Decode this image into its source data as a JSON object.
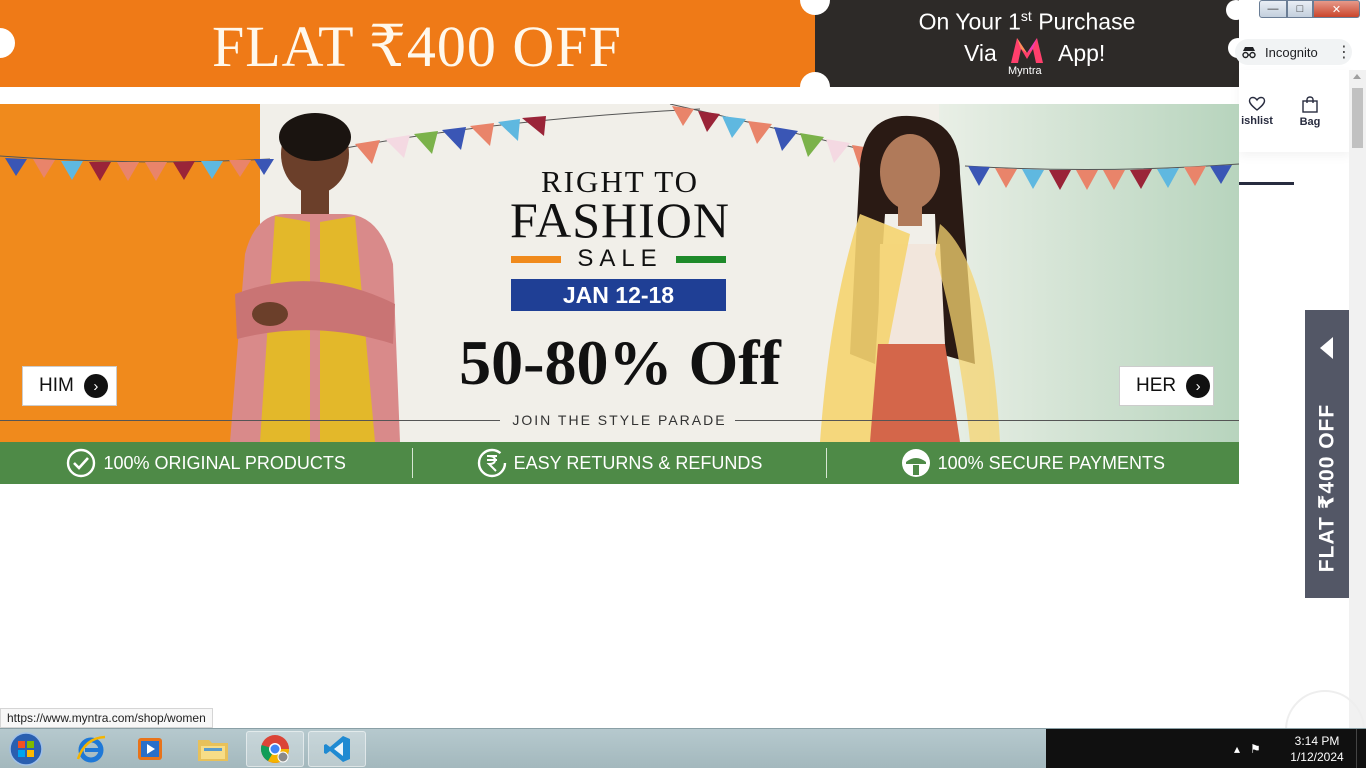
{
  "promo_banner": {
    "headline": "FLAT ₹400 OFF",
    "line1_prefix": "On Your 1",
    "line1_sup": "st",
    "line1_suffix": " Purchase",
    "via": "Via",
    "app": "App!",
    "brand": "Myntra",
    "colors": {
      "orange": "#ef7a17",
      "dark": "#2d2a28"
    }
  },
  "browser": {
    "incognito_label": "Incognito",
    "window_controls": {
      "minimize": "—",
      "maximize": "□",
      "close": "✕"
    }
  },
  "header": {
    "wishlist_label": "ishlist",
    "bag_label": "Bag"
  },
  "hero": {
    "title_line1": "RIGHT TO",
    "title_line2": "FASHION",
    "title_line3": "SALE",
    "dates": "JAN 12-18",
    "discount": "50-80% Off",
    "tagline": "JOIN THE STYLE PARADE",
    "cta_him": "HIM",
    "cta_her": "HER",
    "colors": {
      "saffron": "#f08a1c",
      "green": "#1e8a2a",
      "navy": "#1f3f95"
    }
  },
  "trust_strip": {
    "items": [
      {
        "label": "100% ORIGINAL PRODUCTS",
        "icon": "check-circle-icon"
      },
      {
        "label": "EASY RETURNS & REFUNDS",
        "icon": "rupee-circle-icon"
      },
      {
        "label": "100% SECURE PAYMENTS",
        "icon": "shield-lock-icon"
      }
    ],
    "color": "#4e8a47"
  },
  "side_tab": {
    "label": "FLAT ₹400 OFF"
  },
  "status_url": "https://www.myntra.com/shop/women",
  "taskbar": {
    "apps": [
      "internet-explorer",
      "media-player",
      "file-explorer",
      "chrome",
      "vscode"
    ],
    "time": "3:14 PM",
    "date": "1/12/2024"
  }
}
